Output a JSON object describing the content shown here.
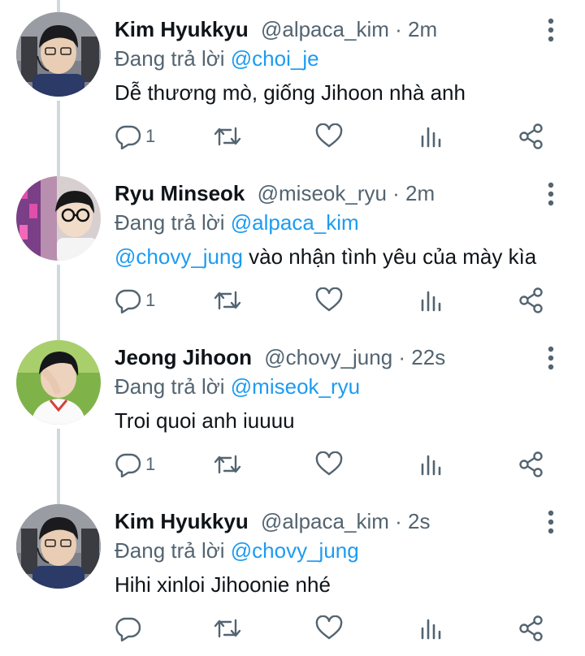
{
  "colors": {
    "name": "#0f1419",
    "meta": "#536471",
    "mention": "#1d9bf0",
    "icon": "#536471",
    "thread_line": "#cfd9de"
  },
  "tweets": [
    {
      "name": "Kim Hyukkyu",
      "handle": "@alpaca_kim",
      "time": "· 2m",
      "replying_prefix": "Đang trả lời ",
      "replying_to": "@choi_je",
      "text_mention": "",
      "text": "Dễ thương mò, giống Jihoon nhà anh",
      "reply_count": "1",
      "avatar": "avatar-kim"
    },
    {
      "name": "Ryu Minseok",
      "handle": "@miseok_ryu",
      "time": "· 2m",
      "replying_prefix": "Đang trả lời ",
      "replying_to": "@alpaca_kim",
      "text_mention": "@chovy_jung",
      "text": " vào nhận tình yêu của mày kìa",
      "reply_count": "1",
      "avatar": "avatar-ryu"
    },
    {
      "name": "Jeong Jihoon",
      "handle": "@chovy_jung",
      "time": "· 22s",
      "replying_prefix": "Đang trả lời ",
      "replying_to": "@miseok_ryu",
      "text_mention": "",
      "text": "Troi quoi anh iuuuu",
      "reply_count": "1",
      "avatar": "avatar-jeong"
    },
    {
      "name": "Kim Hyukkyu",
      "handle": "@alpaca_kim",
      "time": "· 2s",
      "replying_prefix": "Đang trả lời ",
      "replying_to": "@chovy_jung",
      "text_mention": "",
      "text": "Hihi xinloi Jihoonie nhé",
      "reply_count": "",
      "avatar": "avatar-kim"
    }
  ]
}
